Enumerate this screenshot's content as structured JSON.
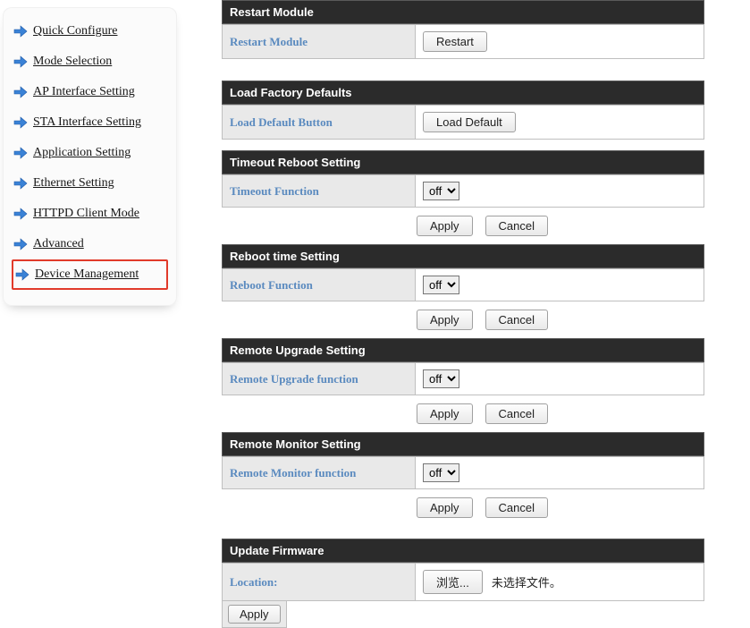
{
  "sidebar": {
    "items": [
      {
        "label": "Quick Configure"
      },
      {
        "label": "Mode Selection"
      },
      {
        "label": "AP Interface Setting"
      },
      {
        "label": "STA Interface Setting"
      },
      {
        "label": "Application Setting"
      },
      {
        "label": "Ethernet Setting"
      },
      {
        "label": "HTTPD Client Mode"
      },
      {
        "label": "Advanced"
      },
      {
        "label": "Device Management"
      }
    ]
  },
  "buttons": {
    "restart": "Restart",
    "loadDefault": "Load Default",
    "apply": "Apply",
    "cancel": "Cancel",
    "browse": "浏览..."
  },
  "select": {
    "off": "off"
  },
  "sections": {
    "restartModule": {
      "title": "Restart Module",
      "row": "Restart Module"
    },
    "loadFactory": {
      "title": "Load Factory Defaults",
      "row": "Load Default Button"
    },
    "timeoutReboot": {
      "title": "Timeout Reboot Setting",
      "row": "Timeout Function"
    },
    "rebootTime": {
      "title": "Reboot time Setting",
      "row": "Reboot Function"
    },
    "remoteUpgrade": {
      "title": "Remote Upgrade Setting",
      "row": "Remote Upgrade function"
    },
    "remoteMonitor": {
      "title": "Remote Monitor Setting",
      "row": "Remote Monitor function"
    },
    "updateFirmware": {
      "title": "Update Firmware",
      "row": "Location:",
      "noFile": "未选择文件。"
    }
  }
}
